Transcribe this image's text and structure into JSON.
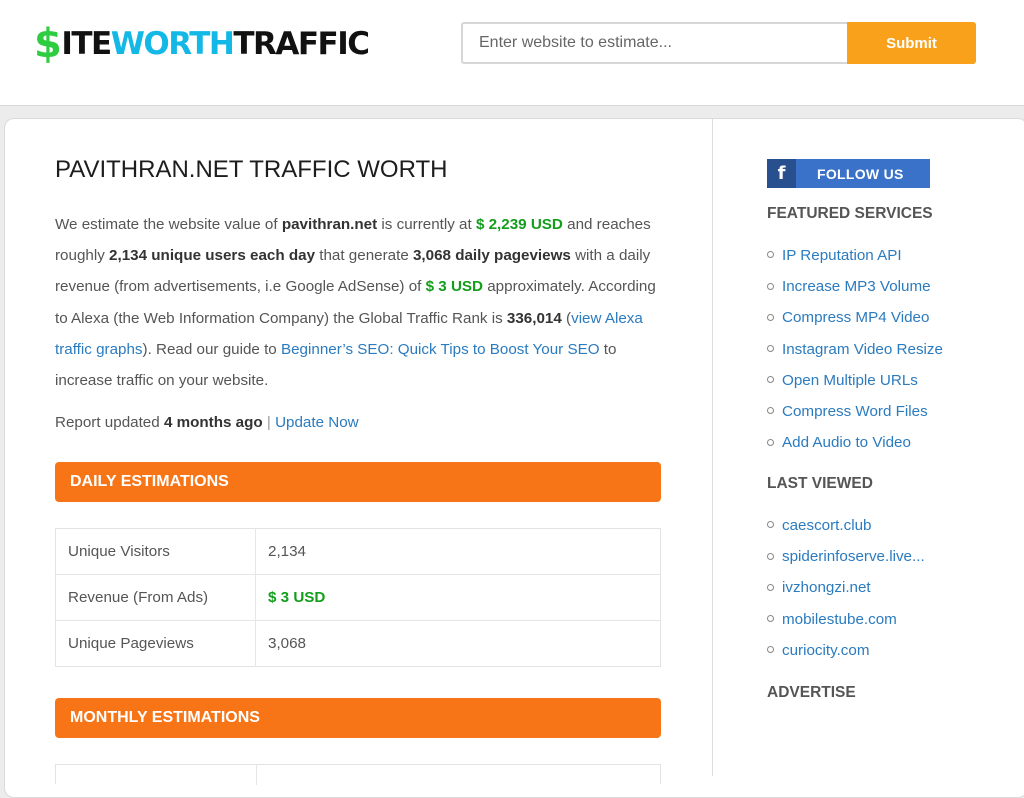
{
  "header": {
    "logo": {
      "dollar": "$",
      "part1": "ITE",
      "part2": "WORTH",
      "part3": "TRAFFIC"
    },
    "search_placeholder": "Enter website to estimate...",
    "submit_label": "Submit"
  },
  "main": {
    "title": "PAVITHRAN.NET TRAFFIC WORTH",
    "intro": {
      "t1": "We estimate the website value of ",
      "domain": "pavithran.net",
      "t2": " is currently at ",
      "value": "$ 2,239 USD",
      "t3": " and reaches roughly ",
      "users": "2,134 unique users each day",
      "t4": " that generate ",
      "pageviews": "3,068 daily pageviews",
      "t5": " with a daily revenue (from advertisements, i.e Google AdSense) of ",
      "revenue": "$ 3 USD",
      "t6": " approximately. According to Alexa (the Web Information Company) the Global Traffic Rank is ",
      "rank": "336,014",
      "t7": " (",
      "alexa_link": "view Alexa traffic graphs",
      "t8": "). Read our guide to ",
      "seo_link": "Beginner’s SEO: Quick Tips to Boost Your SEO",
      "t9": " to increase traffic on your website."
    },
    "updated": {
      "prefix": "Report updated ",
      "age": "4 months ago",
      "sep": " | ",
      "link": "Update Now"
    },
    "daily_heading": "DAILY ESTIMATIONS",
    "daily_rows": [
      {
        "label": "Unique Visitors",
        "value": "2,134"
      },
      {
        "label": "Revenue (From Ads)",
        "value": "$ 3 USD"
      },
      {
        "label": "Unique Pageviews",
        "value": "3,068"
      }
    ],
    "monthly_heading": "MONTHLY ESTIMATIONS"
  },
  "sidebar": {
    "follow_icon": "f",
    "follow_label": "FOLLOW US",
    "featured_heading": "FEATURED SERVICES",
    "featured_items": [
      "IP Reputation API",
      "Increase MP3 Volume",
      "Compress MP4 Video",
      "Instagram Video Resize",
      "Open Multiple URLs",
      "Compress Word Files",
      "Add Audio to Video"
    ],
    "last_viewed_heading": "LAST VIEWED",
    "last_viewed_items": [
      "caescort.club",
      "spiderinfoserve.live...",
      "ivzhongzi.net",
      "mobilestube.com",
      "curiocity.com"
    ],
    "advertise_heading": "ADVERTISE"
  },
  "colors": {
    "accent_orange": "#f77516",
    "submit_orange": "#f9a11b",
    "value_green": "#139e1c",
    "link_blue": "#2b7bbf",
    "facebook_blue": "#3b72c9"
  }
}
